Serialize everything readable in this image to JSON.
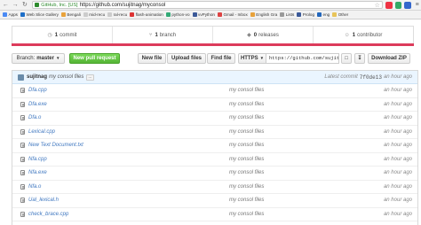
{
  "browser": {
    "secure_label": "GitHub, Inc. [US]",
    "url": "https://github.com/sujitnag/myconsol",
    "bookmarks": [
      {
        "label": "Apps",
        "color": "#4a8af4"
      },
      {
        "label": "Web Slice Gallery",
        "color": "#1e6fc8"
      },
      {
        "label": "Bengali",
        "color": "#e8a23b"
      },
      {
        "label": "mid-recu",
        "color": "#cccccc"
      },
      {
        "label": "ral-recu",
        "color": "#cccccc"
      },
      {
        "label": "flash-animation",
        "color": "#d33"
      },
      {
        "label": "python-vo",
        "color": "#3a7"
      },
      {
        "label": "vvPython",
        "color": "#3b5998"
      },
      {
        "label": "Gmail - Inbox",
        "color": "#d44"
      },
      {
        "label": "English Gra",
        "color": "#e8a23b"
      },
      {
        "label": "Lists",
        "color": "#999999"
      },
      {
        "label": "Prolog",
        "color": "#3b5998"
      },
      {
        "label": "eng",
        "color": "#2266bb"
      },
      {
        "label": "Other",
        "color": "#e8c45a"
      }
    ]
  },
  "stats": [
    {
      "count": "1",
      "label": "commit",
      "icon": "commit-icon"
    },
    {
      "count": "1",
      "label": "branch",
      "icon": "branch-icon"
    },
    {
      "count": "0",
      "label": "releases",
      "icon": "tag-icon"
    },
    {
      "count": "1",
      "label": "contributor",
      "icon": "people-icon"
    }
  ],
  "language_bar_color": "#dc3b5b",
  "toolbar": {
    "branch_label": "Branch:",
    "branch_name": "master",
    "pull_request": "New pull request",
    "new_file": "New file",
    "upload_files": "Upload files",
    "find_file": "Find file",
    "clone_protocol": "HTTPS",
    "clone_url": "https://github.com/sujitn",
    "download_zip": "Download ZIP"
  },
  "commit": {
    "author": "sujitnag",
    "message": "my consol files",
    "ellipsis": "...",
    "latest_label": "Latest commit",
    "sha": "7f0de13",
    "age": "an hour ago"
  },
  "files": [
    {
      "name": "Dfa.cpp",
      "message": "my consol files",
      "age": "an hour ago"
    },
    {
      "name": "Dfa.exe",
      "message": "my consol files",
      "age": "an hour ago"
    },
    {
      "name": "Dfa.o",
      "message": "my consol files",
      "age": "an hour ago"
    },
    {
      "name": "Lexical.cpp",
      "message": "my consol files",
      "age": "an hour ago"
    },
    {
      "name": "New Text Document.txt",
      "message": "my consol files",
      "age": "an hour ago"
    },
    {
      "name": "Nfa.cpp",
      "message": "my consol files",
      "age": "an hour ago"
    },
    {
      "name": "Nfa.exe",
      "message": "my consol files",
      "age": "an hour ago"
    },
    {
      "name": "Nfa.o",
      "message": "my consol files",
      "age": "an hour ago"
    },
    {
      "name": "Ual_lexical.h",
      "message": "my consol files",
      "age": "an hour ago"
    },
    {
      "name": "check_brace.cpp",
      "message": "my consol files",
      "age": "an hour ago"
    },
    {
      "name": "check_brace.exe",
      "message": "my consol files",
      "age": "an hour ago"
    }
  ]
}
